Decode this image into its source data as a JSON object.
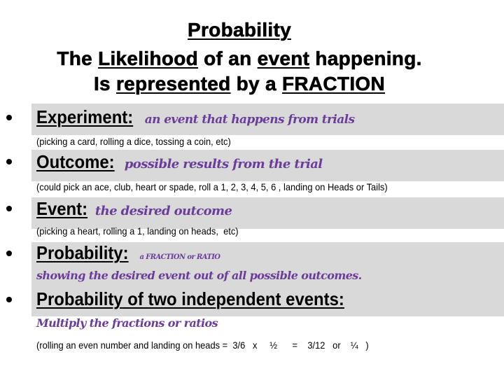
{
  "title": {
    "line1": {
      "underlined": "Probability"
    },
    "line2": {
      "pre": "The ",
      "u1": "Likelihood",
      "mid": " of an ",
      "u2": "event",
      "post": " happening."
    },
    "line3": {
      "pre": "Is ",
      "u1": "represented",
      "mid": " by a ",
      "u2": "FRACTION"
    }
  },
  "colors": {
    "definition_purple": "#6a3d9a",
    "band_gray": "#d9d9d9"
  },
  "items": [
    {
      "term": "Experiment:",
      "definition": "an event that happens from trials",
      "example": "(picking a card, rolling a dice, tossing a coin, etc)"
    },
    {
      "term": "Outcome:",
      "definition": "possible results from the trial",
      "example": "(could pick an ace, club, heart or spade, roll a 1, 2, 3, 4, 5, 6 , landing on Heads or Tails)"
    },
    {
      "term": "Event:",
      "definition": "the desired outcome",
      "example": "(picking a heart, rolling a 1, landing on heads,  etc)"
    },
    {
      "term": "Probability:",
      "definition": "a FRACTION  or RATIO",
      "definition_line2": "showing the desired event out of all possible outcomes."
    },
    {
      "term": "Probability of two independent events:",
      "definition": "Multiply the fractions or ratios",
      "example": "(rolling an even number and landing on heads =  3/6   x     ½      =    3/12   or    ¼   )"
    }
  ]
}
